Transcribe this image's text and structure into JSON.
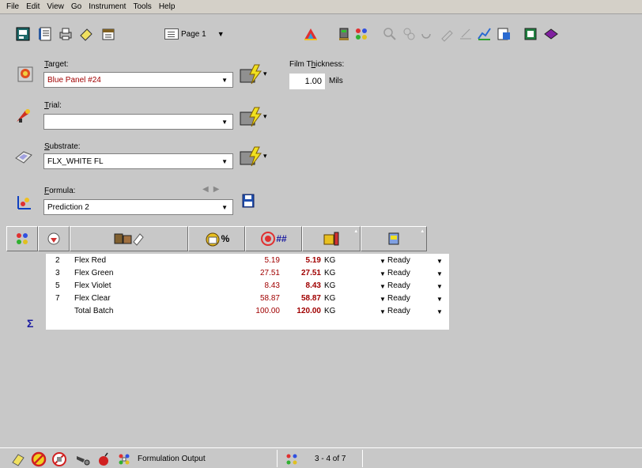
{
  "menu": [
    "File",
    "Edit",
    "View",
    "Go",
    "Instrument",
    "Tools",
    "Help"
  ],
  "toolbar": {
    "page_label": "Page 1"
  },
  "form": {
    "target": {
      "label_prefix": "",
      "label_u": "T",
      "label_rest": "arget:",
      "value": "Blue Panel #24"
    },
    "trial": {
      "label_u": "T",
      "label_rest": "rial:",
      "value": ""
    },
    "substrate": {
      "label_u": "S",
      "label_rest": "ubstrate:",
      "value": "FLX_WHITE FL"
    },
    "formula": {
      "label_u": "F",
      "label_rest": "ormula:",
      "value": "Prediction 2"
    },
    "film_thickness": {
      "label_pre": "Film T",
      "label_u": "h",
      "label_rest": "ickness:",
      "value": "1.00",
      "unit": "Mils"
    }
  },
  "grid": {
    "rows": [
      {
        "num": "2",
        "name": "Flex Red",
        "pct": "5.19",
        "amount": "5.19",
        "unit": "KG",
        "status": "Ready"
      },
      {
        "num": "3",
        "name": "Flex Green",
        "pct": "27.51",
        "amount": "27.51",
        "unit": "KG",
        "status": "Ready"
      },
      {
        "num": "5",
        "name": "Flex Violet",
        "pct": "8.43",
        "amount": "8.43",
        "unit": "KG",
        "status": "Ready"
      },
      {
        "num": "7",
        "name": "Flex Clear",
        "pct": "58.87",
        "amount": "58.87",
        "unit": "KG",
        "status": "Ready"
      },
      {
        "num": "",
        "name": "Total Batch",
        "pct": "100.00",
        "amount": "120.00",
        "unit": "KG",
        "status": "Ready"
      }
    ],
    "sigma": "Σ",
    "pct_header": "%",
    "amount_header": "##"
  },
  "status": {
    "output_label": "Formulation Output",
    "record": "3 - 4 of 7"
  },
  "colors": {
    "value_red": "#a00000",
    "sigma_blue": "#1a1aa0",
    "window_gray": "#c8c8c8"
  }
}
